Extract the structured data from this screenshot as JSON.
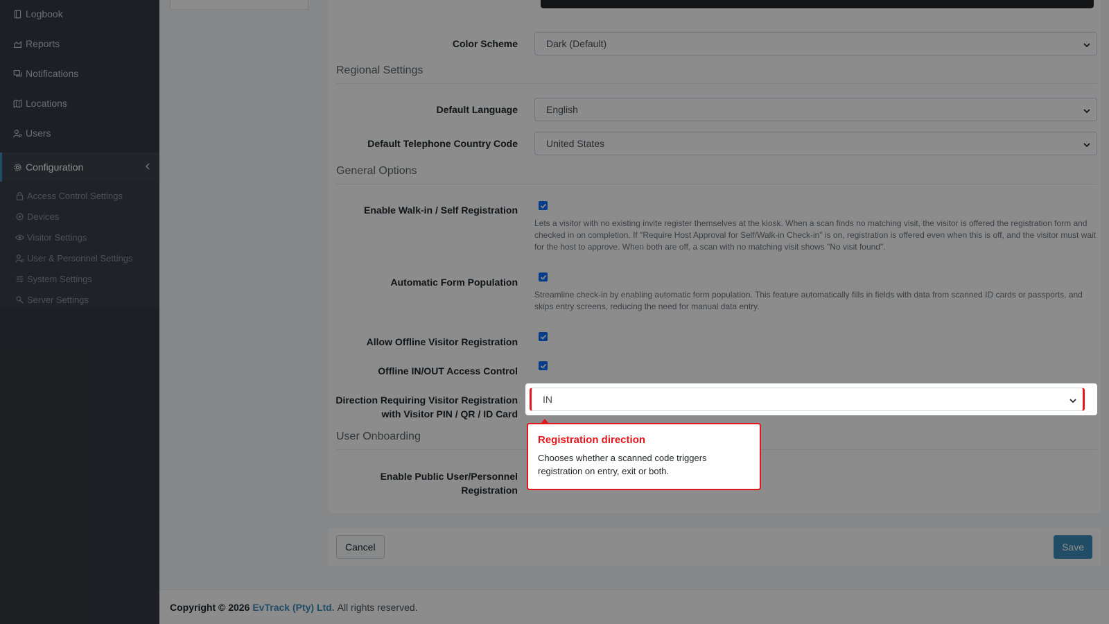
{
  "sidebar": {
    "items": [
      {
        "label": "Logbook",
        "icon": "book-icon"
      },
      {
        "label": "Reports",
        "icon": "chart-icon"
      },
      {
        "label": "Notifications",
        "icon": "chat-icon"
      },
      {
        "label": "Locations",
        "icon": "map-icon"
      },
      {
        "label": "Users",
        "icon": "users-icon"
      },
      {
        "label": "Configuration",
        "icon": "gear-icon"
      }
    ],
    "submenu": [
      {
        "label": "Access Control Settings",
        "icon": "lock-icon"
      },
      {
        "label": "Devices",
        "icon": "devices-icon"
      },
      {
        "label": "Visitor Settings",
        "icon": "eye-icon"
      },
      {
        "label": "User & Personnel Settings",
        "icon": "user-cog-icon"
      },
      {
        "label": "System Settings",
        "icon": "sliders-icon"
      },
      {
        "label": "Server Settings",
        "icon": "server-icon"
      }
    ]
  },
  "form": {
    "color_scheme": {
      "label": "Color Scheme",
      "value": "Dark (Default)"
    },
    "regional_title": "Regional Settings",
    "default_language": {
      "label": "Default Language",
      "value": "English"
    },
    "country_code": {
      "label": "Default Telephone Country Code",
      "value": "United States"
    },
    "general_title": "General Options",
    "walkin": {
      "label": "Enable Walk-in / Self Registration",
      "checked": true,
      "help": "Lets a visitor with no existing invite register themselves at the kiosk. When a scan finds no matching visit, the visitor is offered the registration form and checked in on completion. If \"Require Host Approval for Self/Walk-in Check-in\" is on, registration is offered even when this is off, and the visitor must wait for the host to approve. When both are off, a scan with no matching visit shows \"No visit found\"."
    },
    "autoform": {
      "label": "Automatic Form Population",
      "checked": true,
      "help": "Streamline check-in by enabling automatic form population. This feature automatically fills in fields with data from scanned ID cards or passports, and skips entry screens, reducing the need for manual data entry."
    },
    "offline_reg": {
      "label": "Allow Offline Visitor Registration",
      "checked": true
    },
    "offline_access": {
      "label": "Offline IN/OUT Access Control",
      "checked": true
    },
    "direction": {
      "label_line1": "Direction Requiring Visitor Registration",
      "label_line2": "with Visitor PIN / QR / ID Card",
      "value": "IN"
    },
    "onboarding_title": "User Onboarding",
    "public_reg": {
      "label_line1": "Enable Public User/Personnel",
      "label_line2": "Registration"
    }
  },
  "buttons": {
    "cancel": "Cancel",
    "save": "Save"
  },
  "footer": {
    "copyright": "Copyright © 2026",
    "brand": "EvTrack (Pty) Ltd.",
    "rights": "All rights reserved."
  },
  "tooltip": {
    "title": "Registration direction",
    "body": "Chooses whether a scanned code triggers registration on entry, exit or both."
  },
  "colors": {
    "accent": "#3c8dbc",
    "highlight": "#e3161d",
    "sidebar": "#343a40"
  }
}
